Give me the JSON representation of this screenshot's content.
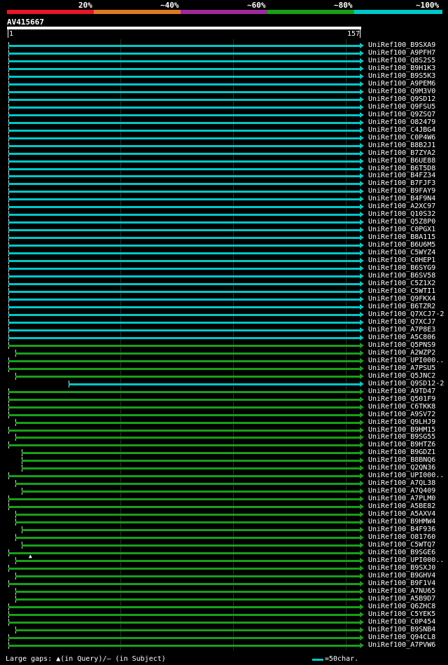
{
  "legend": {
    "segments": [
      {
        "label": "20%",
        "color": "#e8152a"
      },
      {
        "label": "~40%",
        "color": "#e07a1f"
      },
      {
        "label": "~60%",
        "color": "#a0289c"
      },
      {
        "label": "~80%",
        "color": "#18a018"
      },
      {
        "label": "~100%",
        "color": "#00c8c8"
      }
    ]
  },
  "query": {
    "name": "AV415667",
    "start": "1",
    "end": "157"
  },
  "footer": {
    "gaps_text": "Large gaps: ▲(in Query)/– (in Subject)",
    "scale_text": "=50char."
  },
  "hits": [
    {
      "name": "UniRef100_B9SXA9",
      "color": "cyan",
      "start": 1
    },
    {
      "name": "UniRef100_A9PFH7",
      "color": "cyan",
      "start": 1
    },
    {
      "name": "UniRef100_Q8S2S5",
      "color": "cyan",
      "start": 1
    },
    {
      "name": "UniRef100_B9H1K3",
      "color": "cyan",
      "start": 1
    },
    {
      "name": "UniRef100_B9S5K3",
      "color": "cyan",
      "start": 1
    },
    {
      "name": "UniRef100_A9PEM6",
      "color": "cyan",
      "start": 1
    },
    {
      "name": "UniRef100_Q9M3V0",
      "color": "cyan",
      "start": 1
    },
    {
      "name": "UniRef100_Q9SD12",
      "color": "cyan",
      "start": 1
    },
    {
      "name": "UniRef100_Q9FSU5",
      "color": "cyan",
      "start": 1
    },
    {
      "name": "UniRef100_Q9ZSQ7",
      "color": "cyan",
      "start": 1
    },
    {
      "name": "UniRef100_O82479",
      "color": "cyan",
      "start": 1
    },
    {
      "name": "UniRef100_C4JBG4",
      "color": "cyan",
      "start": 1
    },
    {
      "name": "UniRef100_C0P4W6",
      "color": "cyan",
      "start": 1
    },
    {
      "name": "UniRef100_B8B2J1",
      "color": "cyan",
      "start": 1
    },
    {
      "name": "UniRef100_B7ZYA2",
      "color": "cyan",
      "start": 1
    },
    {
      "name": "UniRef100_B6UE88",
      "color": "cyan",
      "start": 1
    },
    {
      "name": "UniRef100_B6T5D8",
      "color": "cyan",
      "start": 1
    },
    {
      "name": "UniRef100_B4FZ34",
      "color": "cyan",
      "start": 1
    },
    {
      "name": "UniRef100_B7FJF3",
      "color": "cyan",
      "start": 1
    },
    {
      "name": "UniRef100_B9FAY9",
      "color": "cyan",
      "start": 1
    },
    {
      "name": "UniRef100_B4F9N4",
      "color": "cyan",
      "start": 1
    },
    {
      "name": "UniRef100_A2XC97",
      "color": "cyan",
      "start": 1
    },
    {
      "name": "UniRef100_Q10S32",
      "color": "cyan",
      "start": 1
    },
    {
      "name": "UniRef100_Q5Z8P0",
      "color": "cyan",
      "start": 1
    },
    {
      "name": "UniRef100_C0PGX1",
      "color": "cyan",
      "start": 1
    },
    {
      "name": "UniRef100_B8A115",
      "color": "cyan",
      "start": 1
    },
    {
      "name": "UniRef100_B6U6M5",
      "color": "cyan",
      "start": 1
    },
    {
      "name": "UniRef100_C5WYZ4",
      "color": "cyan",
      "start": 1
    },
    {
      "name": "UniRef100_C0HEP1",
      "color": "cyan",
      "start": 1
    },
    {
      "name": "UniRef100_B6SYG9",
      "color": "cyan",
      "start": 1
    },
    {
      "name": "UniRef100_B6SV58",
      "color": "cyan",
      "start": 1
    },
    {
      "name": "UniRef100_C5Z1X2",
      "color": "cyan",
      "start": 1
    },
    {
      "name": "UniRef100_C5WTI1",
      "color": "cyan",
      "start": 1
    },
    {
      "name": "UniRef100_Q9FKX4",
      "color": "cyan",
      "start": 1
    },
    {
      "name": "UniRef100_B6TZR2",
      "color": "cyan",
      "start": 1
    },
    {
      "name": "UniRef100_Q7XCJ7-2",
      "color": "cyan",
      "start": 1
    },
    {
      "name": "UniRef100_Q7XCJ7",
      "color": "cyan",
      "start": 1
    },
    {
      "name": "UniRef100_A7P8E3",
      "color": "cyan",
      "start": 1
    },
    {
      "name": "UniRef100_A5C806",
      "color": "cyan",
      "start": 1
    },
    {
      "name": "UniRef100_Q5PNS9",
      "color": "green",
      "start": 1
    },
    {
      "name": "UniRef100_A2WZP2",
      "color": "green",
      "start": 4
    },
    {
      "name": "UniRef100_UPI000..",
      "color": "green",
      "start": 1
    },
    {
      "name": "UniRef100_A7PSU5",
      "color": "green",
      "start": 1
    },
    {
      "name": "UniRef100_Q5JNC2",
      "color": "green",
      "start": 4
    },
    {
      "name": "UniRef100_Q9SD12-2",
      "color": "cyan",
      "start": 28
    },
    {
      "name": "UniRef100_A9TD47",
      "color": "green",
      "start": 1
    },
    {
      "name": "UniRef100_Q501F9",
      "color": "green",
      "start": 1
    },
    {
      "name": "UniRef100_C6TKK8",
      "color": "green",
      "start": 1
    },
    {
      "name": "UniRef100_A9SV72",
      "color": "green",
      "start": 1
    },
    {
      "name": "UniRef100_Q9LHJ9",
      "color": "green",
      "start": 4
    },
    {
      "name": "UniRef100_B9HM15",
      "color": "green",
      "start": 1
    },
    {
      "name": "UniRef100_B9SG55",
      "color": "green",
      "start": 4
    },
    {
      "name": "UniRef100_B9HTZ6",
      "color": "green",
      "start": 1
    },
    {
      "name": "UniRef100_B9GDZ1",
      "color": "green",
      "start": 7
    },
    {
      "name": "UniRef100_B8BNQ6",
      "color": "green",
      "start": 7
    },
    {
      "name": "UniRef100_Q2QN36",
      "color": "green",
      "start": 7
    },
    {
      "name": "UniRef100_UPI000..",
      "color": "green",
      "start": 1
    },
    {
      "name": "UniRef100_A7QL38",
      "color": "green",
      "start": 4
    },
    {
      "name": "UniRef100_A7Q409",
      "color": "green",
      "start": 7
    },
    {
      "name": "UniRef100_A7PLM0",
      "color": "green",
      "start": 1
    },
    {
      "name": "UniRef100_A5BE82",
      "color": "green",
      "start": 1
    },
    {
      "name": "UniRef100_A5AXV4",
      "color": "green",
      "start": 4
    },
    {
      "name": "UniRef100_B9HMW4",
      "color": "green",
      "start": 4
    },
    {
      "name": "UniRef100_B4F936",
      "color": "green",
      "start": 7
    },
    {
      "name": "UniRef100_O81760",
      "color": "green",
      "start": 4
    },
    {
      "name": "UniRef100_C5WTQ7",
      "color": "green",
      "start": 7
    },
    {
      "name": "UniRef100_B9SGE6",
      "color": "green",
      "start": 1
    },
    {
      "name": "UniRef100_UPI000..",
      "color": "green",
      "start": 4
    },
    {
      "name": "UniRef100_B9SXJ0",
      "color": "green",
      "start": 1
    },
    {
      "name": "UniRef100_B9GHV4",
      "color": "green",
      "start": 4
    },
    {
      "name": "UniRef100_B9F1V4",
      "color": "green",
      "start": 1
    },
    {
      "name": "UniRef100_A7NU65",
      "color": "green",
      "start": 4
    },
    {
      "name": "UniRef100_A5B9D7",
      "color": "green",
      "start": 4
    },
    {
      "name": "UniRef100_Q6ZHC8",
      "color": "green",
      "start": 1
    },
    {
      "name": "UniRef100_C5YEK5",
      "color": "green",
      "start": 1
    },
    {
      "name": "UniRef100_C0P454",
      "color": "green",
      "start": 1
    },
    {
      "name": "UniRef100_B9SNB4",
      "color": "green",
      "start": 4
    },
    {
      "name": "UniRef100_Q94CL8",
      "color": "green",
      "start": 1
    },
    {
      "name": "UniRef100_A7PVW6",
      "color": "green",
      "start": 1
    }
  ]
}
